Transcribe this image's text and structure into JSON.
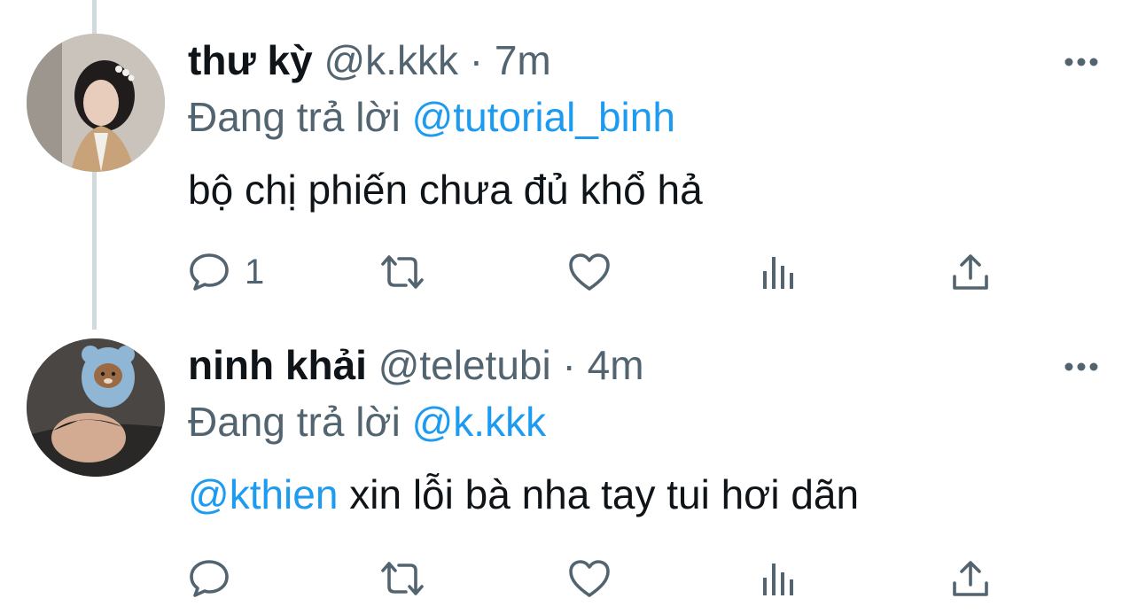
{
  "tweets": [
    {
      "display_name": "thư kỳ",
      "handle": "@k.kkk",
      "separator": "·",
      "time": "7m",
      "reply_prefix": "Đang trả lời",
      "reply_to": "@tutorial_binh",
      "text_mention": "",
      "text": "bộ chị phiến chưa đủ khổ hả",
      "reply_count": "1"
    },
    {
      "display_name": "ninh khải",
      "handle": "@teletubi",
      "separator": "·",
      "time": "4m",
      "reply_prefix": "Đang trả lời",
      "reply_to": "@k.kkk",
      "text_mention": "@kthien",
      "text": " xin lỗi bà nha tay tui hơi dãn",
      "reply_count": ""
    }
  ],
  "icons": {
    "reply": "reply-icon",
    "retweet": "retweet-icon",
    "like": "heart-icon",
    "stats": "analytics-icon",
    "share": "share-icon",
    "more": "more-icon"
  },
  "colors": {
    "text": "#0f1419",
    "secondary": "#536471",
    "link": "#1d9bf0",
    "thread_line": "#cfd9de"
  }
}
